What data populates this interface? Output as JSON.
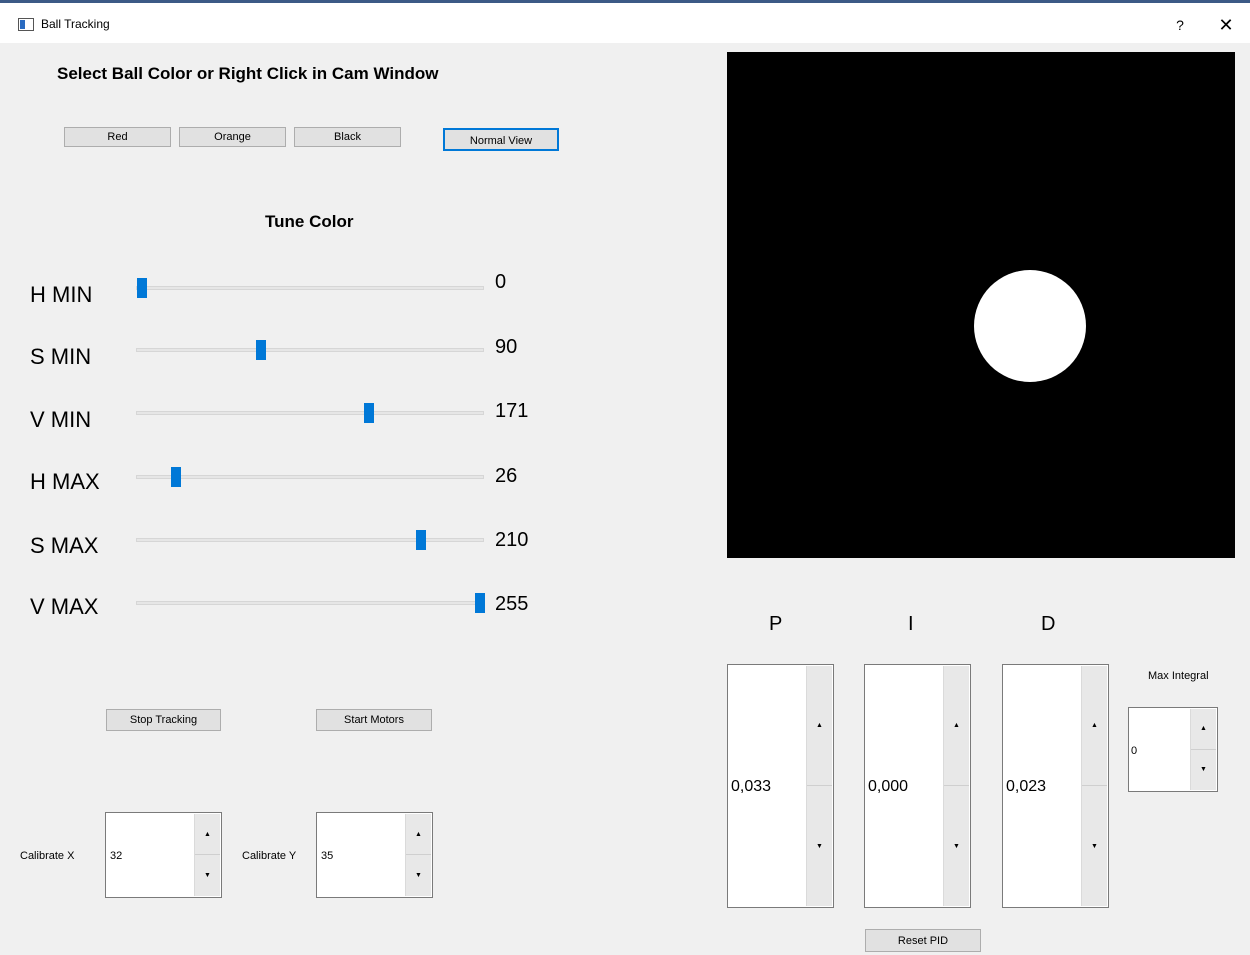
{
  "window": {
    "title": "Ball Tracking",
    "help_glyph": "?",
    "close_glyph": "✕"
  },
  "color_select": {
    "heading": "Select Ball Color or Right Click in Cam Window",
    "buttons": [
      "Red",
      "Orange",
      "Black"
    ],
    "view_button": "Normal View"
  },
  "tune": {
    "heading": "Tune Color",
    "sliders": [
      {
        "label": "H MIN",
        "value": "0",
        "fraction": 0.0
      },
      {
        "label": "S MIN",
        "value": "90",
        "fraction": 0.353
      },
      {
        "label": "V MIN",
        "value": "171",
        "fraction": 0.671
      },
      {
        "label": "H MAX",
        "value": "26",
        "fraction": 0.102
      },
      {
        "label": "S MAX",
        "value": "210",
        "fraction": 0.824
      },
      {
        "label": "V MAX",
        "value": "255",
        "fraction": 1.0
      }
    ]
  },
  "actions": {
    "stop_tracking": "Stop Tracking",
    "start_motors": "Start Motors"
  },
  "calibration": {
    "x_label": "Calibrate X",
    "x_value": "32",
    "y_label": "Calibrate Y",
    "y_value": "35"
  },
  "pid": {
    "p_label": "P",
    "i_label": "I",
    "d_label": "D",
    "p_value": "0,033",
    "i_value": "0,000",
    "d_value": "0,023",
    "max_integral_label": "Max Integral",
    "max_integral_value": "0",
    "reset_button": "Reset PID"
  },
  "spin_glyphs": {
    "up": "▲",
    "down": "▼"
  },
  "colors": {
    "accent": "#0078d7",
    "camera_bg": "#000000",
    "ball": "#ffffff"
  }
}
